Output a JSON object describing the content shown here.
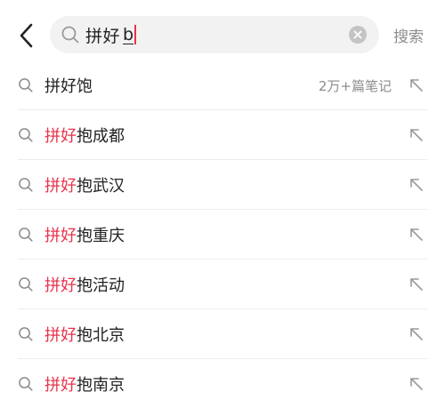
{
  "header": {
    "back_icon": "chevron-left-icon",
    "search": {
      "icon": "search-icon",
      "query_committed": "拼好",
      "query_composing": "b",
      "clear_icon": "clear-circle-icon"
    },
    "search_button_label": "搜索"
  },
  "suggestions": [
    {
      "highlight": "",
      "rest": "拼好饱",
      "count": "2万+篇笔记",
      "fill_icon": "arrow-up-left-icon"
    },
    {
      "highlight": "拼好",
      "rest": "抱成都",
      "count": "",
      "fill_icon": "arrow-up-left-icon"
    },
    {
      "highlight": "拼好",
      "rest": "抱武汉",
      "count": "",
      "fill_icon": "arrow-up-left-icon"
    },
    {
      "highlight": "拼好",
      "rest": "抱重庆",
      "count": "",
      "fill_icon": "arrow-up-left-icon"
    },
    {
      "highlight": "拼好",
      "rest": "抱活动",
      "count": "",
      "fill_icon": "arrow-up-left-icon"
    },
    {
      "highlight": "拼好",
      "rest": "抱北京",
      "count": "",
      "fill_icon": "arrow-up-left-icon"
    },
    {
      "highlight": "拼好",
      "rest": "抱南京",
      "count": "",
      "fill_icon": "arrow-up-left-icon"
    }
  ],
  "colors": {
    "highlight": "#e8334a",
    "text": "#222222",
    "muted": "#8c8c8c",
    "search_bg": "#f2f2f2"
  }
}
